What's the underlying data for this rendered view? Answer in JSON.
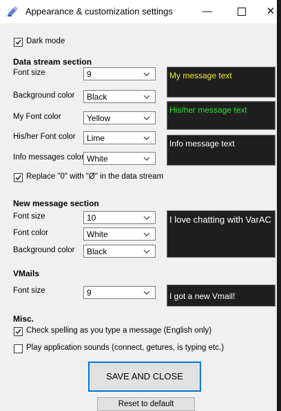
{
  "window": {
    "title": "Appearance & customization settings",
    "minimize_glyph": "—",
    "close_glyph": "✕"
  },
  "dark_mode": {
    "label": "Dark mode",
    "checked": true
  },
  "data_stream": {
    "title": "Data stream section",
    "font_size": {
      "label": "Font size",
      "value": "9"
    },
    "background_color": {
      "label": "Background color",
      "value": "Black"
    },
    "my_font_color": {
      "label": "My Font color",
      "value": "Yellow"
    },
    "his_her_font_color": {
      "label": "His/her Font color",
      "value": "Lime"
    },
    "info_messages_color": {
      "label": "Info messages color",
      "value": "White"
    },
    "replace_zero": {
      "label": "Replace \"0\" with \"Ø\" in the data stream",
      "checked": true
    },
    "preview_my": "My message text",
    "preview_his": "His/her message text",
    "preview_info": "Info message text"
  },
  "new_message": {
    "title": "New message section",
    "font_size": {
      "label": "Font size",
      "value": "10"
    },
    "font_color": {
      "label": "Font color",
      "value": "White"
    },
    "background_color": {
      "label": "Background color",
      "value": "Black"
    },
    "preview": "I love chatting with VarAC"
  },
  "vmails": {
    "title": "VMails",
    "font_size": {
      "label": "Font size",
      "value": "9"
    },
    "preview": "I got a new Vmail!"
  },
  "misc": {
    "title": "Misc.",
    "spell_check": {
      "label": "Check spelling as you type a message (English only)",
      "checked": true
    },
    "play_sounds": {
      "label": "Play application sounds (connect, getures, is typing etc.)",
      "checked": false
    }
  },
  "buttons": {
    "save_close": "SAVE AND CLOSE",
    "reset": "Reset to default"
  },
  "colors": {
    "yellow": "#f2e93b",
    "lime": "#2fe02f",
    "white": "#ffffff",
    "accent": "#0078d7"
  }
}
